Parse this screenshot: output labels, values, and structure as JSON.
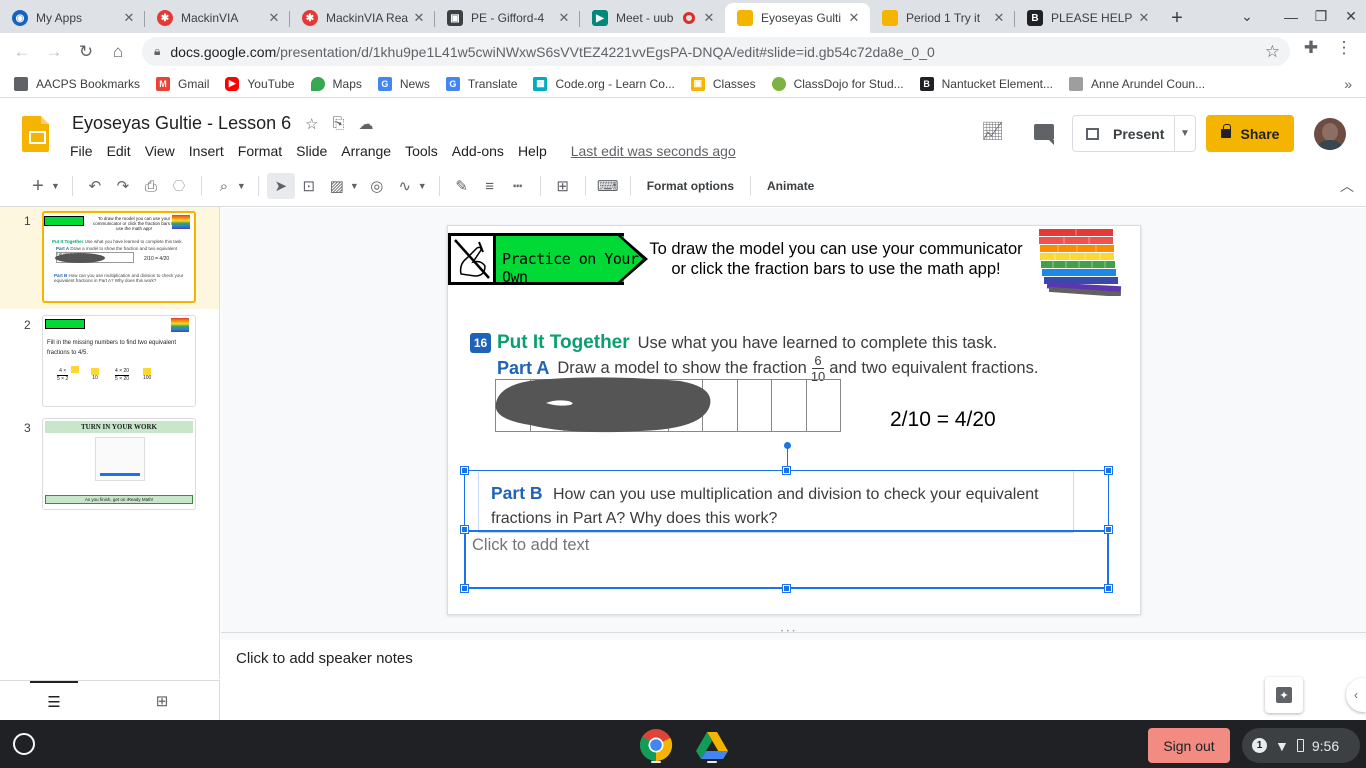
{
  "browser": {
    "tabs": [
      {
        "title": "My Apps",
        "icon_color": "#1565c0",
        "icon": "globe-icon"
      },
      {
        "title": "MackinVIA",
        "icon_color": "#e53935",
        "icon": "pinwheel-icon"
      },
      {
        "title": "MackinVIA Rea",
        "icon_color": "#e53935",
        "icon": "pinwheel-icon"
      },
      {
        "title": "PE - Gifford-4",
        "icon_color": "#3c4043",
        "icon": "classroom-icon"
      },
      {
        "title": "Meet - uub",
        "icon_color": "#00897b",
        "icon": "meet-icon"
      },
      {
        "title": "Eyoseyas Gulti",
        "icon_color": "#f4b400",
        "icon": "slides-icon"
      },
      {
        "title": "Period 1 Try it",
        "icon_color": "#f4b400",
        "icon": "slides-icon"
      },
      {
        "title": "PLEASE HELP",
        "icon_color": "#202124",
        "icon": "brainly-icon"
      }
    ],
    "active_tab_index": 5,
    "new_tab": "+",
    "url_host": "docs.google.com",
    "url_path": "/presentation/d/1khu9pe1L41w5cwiNWxwS6sVVtEZ4221vvEgsPA-DNQA/edit#slide=id.gb54c72da8e_0_0"
  },
  "bookmarks": [
    {
      "label": "AACPS Bookmarks",
      "icon": "folder-icon",
      "color": "#5f6368"
    },
    {
      "label": "Gmail",
      "icon": "gmail-icon",
      "color": "#ea4335"
    },
    {
      "label": "YouTube",
      "icon": "youtube-icon",
      "color": "#ff0000"
    },
    {
      "label": "Maps",
      "icon": "maps-icon",
      "color": "#34a853"
    },
    {
      "label": "News",
      "icon": "news-icon",
      "color": "#4285f4"
    },
    {
      "label": "Translate",
      "icon": "translate-icon",
      "color": "#4285f4"
    },
    {
      "label": "Code.org - Learn Co...",
      "icon": "codeorg-icon",
      "color": "#00adbc"
    },
    {
      "label": "Classes",
      "icon": "classes-icon",
      "color": "#f4b400"
    },
    {
      "label": "ClassDojo for Stud...",
      "icon": "classdojo-icon",
      "color": "#7cb342"
    },
    {
      "label": "Nantucket Element...",
      "icon": "school-icon",
      "color": "#202124"
    },
    {
      "label": "Anne Arundel Coun...",
      "icon": "county-icon",
      "color": "#9e9e9e"
    }
  ],
  "app": {
    "title": "Eyoseyas Gultie - Lesson 6",
    "menu": [
      "File",
      "Edit",
      "View",
      "Insert",
      "Format",
      "Slide",
      "Arrange",
      "Tools",
      "Add-ons",
      "Help"
    ],
    "last_edit": "Last edit was seconds ago",
    "present_label": "Present",
    "share_label": "Share"
  },
  "toolbar": {
    "format_options": "Format options",
    "animate": "Animate"
  },
  "filmstrip": {
    "slides": [
      {
        "number": "1",
        "active": true
      },
      {
        "number": "2",
        "active": false
      },
      {
        "number": "3",
        "active": false
      }
    ],
    "thumb1": {
      "banner": "Practice on Your Own",
      "instr": "To draw the model you can use your communicator or click the fraction bars to use the math app!",
      "put": "Put It Together",
      "use": "Use what you have learned to complete this task.",
      "parta": "Part A",
      "parta_text": "Draw a model to show the fraction and two equivalent fractions.",
      "eq": "2/10 = 4/20",
      "partb": "Part B",
      "partb_text": "How can you use multiplication and division to check your equivalent fractions in Part A? Why does this work?"
    },
    "thumb2": {
      "banner": "Practice on Your Own",
      "text": "Fill in the missing numbers to find two equivalent fractions to",
      "frac_target_num": "4",
      "frac_target_den": "5",
      "eq1_num": "4 ×",
      "eq1_den": "5 × 2",
      "eq1_rhs_den": "10",
      "eq2_num": "4 × 20",
      "eq2_den": "5 × 20",
      "eq2_rhs_den": "100"
    },
    "thumb3": {
      "title": "TURN IN YOUR WORK",
      "footer": "As you finish, get on iReady Math!"
    }
  },
  "slide": {
    "banner_text": "Practice on Your Own",
    "instructions": "To draw the model you can use your communicator or click the fraction bars to use the math app!",
    "task_number": "16",
    "put_it_together": "Put It Together",
    "use_what": "Use what you have learned to complete this task.",
    "parta_label": "Part A",
    "parta_text_before": "Draw a model to show the fraction",
    "fraction_num": "6",
    "fraction_den": "10",
    "parta_text_after": "and two equivalent fractions.",
    "equation": "2/10 = 4/20",
    "partb_label": "Part B",
    "partb_text": "How can you use multiplication and division to check your equivalent fractions in Part A? Why does this work?",
    "placeholder": "Click to add text"
  },
  "notes": {
    "placeholder": "Click to add speaker notes"
  },
  "shelf": {
    "signout": "Sign out",
    "notif_count": "1",
    "time": "9:56"
  }
}
